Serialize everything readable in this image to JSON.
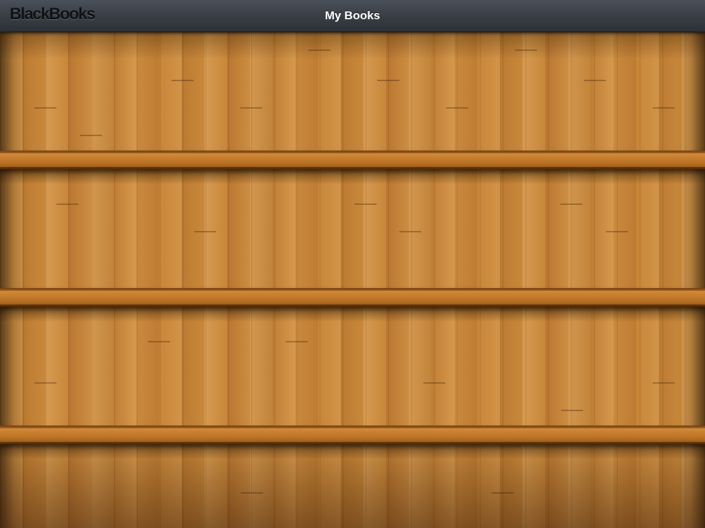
{
  "navbar": {
    "brand": "BlackBooks",
    "title": "My Books"
  },
  "colors": {
    "navbar": "#3a4047",
    "wood": "#c98a3c",
    "shelf_board": "#c57c2c",
    "title_text": "#ffffff"
  },
  "shelves": {
    "count": 3,
    "books": []
  }
}
